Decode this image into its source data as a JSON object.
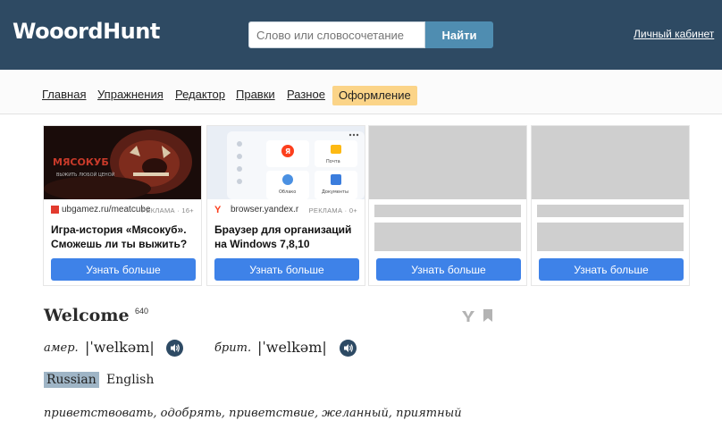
{
  "header": {
    "logo": "WooordHunt",
    "search_placeholder": "Слово или словосочетание",
    "search_button": "Найти",
    "cabinet_link": "Личный кабинет"
  },
  "nav": {
    "items": [
      "Главная",
      "Упражнения",
      "Редактор",
      "Правки",
      "Разное",
      "Оформление"
    ],
    "active": "Оформление"
  },
  "ads": [
    {
      "source": "ubgamez.ru/meatcube",
      "tag": "РЕКЛАМА · 16+",
      "title": "Игра-история «Мясокуб». Сможешь ли ты выжить?",
      "button": "Узнать больше",
      "image_text": "МЯСОКУБ",
      "image_sub": "ВЫЖИТЬ ЛЮБОЙ ЦЕНОЙ"
    },
    {
      "source": "browser.yandex.r",
      "tag": "РЕКЛАМА · 0+",
      "title": "Браузер для организаций на Windows 7,8,10",
      "button": "Узнать больше",
      "tile_mail": "Почта",
      "tile_cloud": "Облако",
      "tile_docs": "Документы"
    },
    {
      "button": "Узнать больше"
    },
    {
      "button": "Узнать больше"
    }
  ],
  "word": {
    "headword": "Welcome",
    "count": "640",
    "us_label": "амер.",
    "us_pron": "|ˈwelkəm|",
    "uk_label": "брит.",
    "uk_pron": "|ˈwelkəm|",
    "lang_active": "Russian",
    "lang_other": "English",
    "translation": "приветствовать, одобрять, приветствие, желанный, приятный"
  },
  "colors": {
    "header_bg": "#2e4a63",
    "search_button_bg": "#4f8db1",
    "nav_active_bg": "#fbd488",
    "ad_button_bg": "#3e82e8"
  }
}
